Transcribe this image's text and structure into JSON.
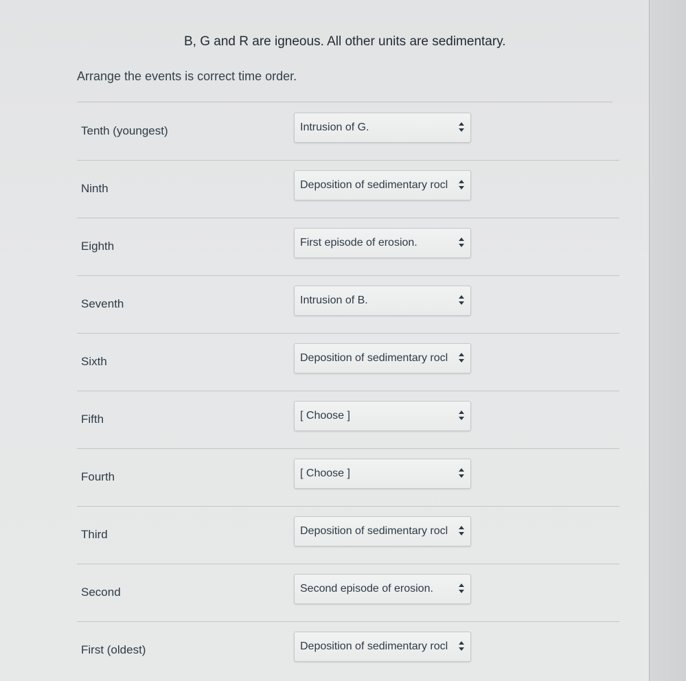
{
  "header": {
    "notice": "B, G and R are igneous.  All other units are sedimentary.",
    "instructions": "Arrange the events is correct time order."
  },
  "rows": [
    {
      "label": "Tenth (youngest)",
      "value": "Intrusion of G."
    },
    {
      "label": "Ninth",
      "value": "Deposition of sedimentary rocl"
    },
    {
      "label": "Eighth",
      "value": "First episode of erosion."
    },
    {
      "label": "Seventh",
      "value": "Intrusion of B."
    },
    {
      "label": "Sixth",
      "value": "Deposition of sedimentary rocl"
    },
    {
      "label": "Fifth",
      "value": "[ Choose ]"
    },
    {
      "label": "Fourth",
      "value": "[ Choose ]"
    },
    {
      "label": "Third",
      "value": "Deposition of sedimentary rocl"
    },
    {
      "label": "Second",
      "value": "Second episode of erosion."
    },
    {
      "label": "First (oldest)",
      "value": "Deposition of sedimentary rocl"
    }
  ],
  "icons": {
    "select_arrows": "up-down-arrows-icon"
  }
}
